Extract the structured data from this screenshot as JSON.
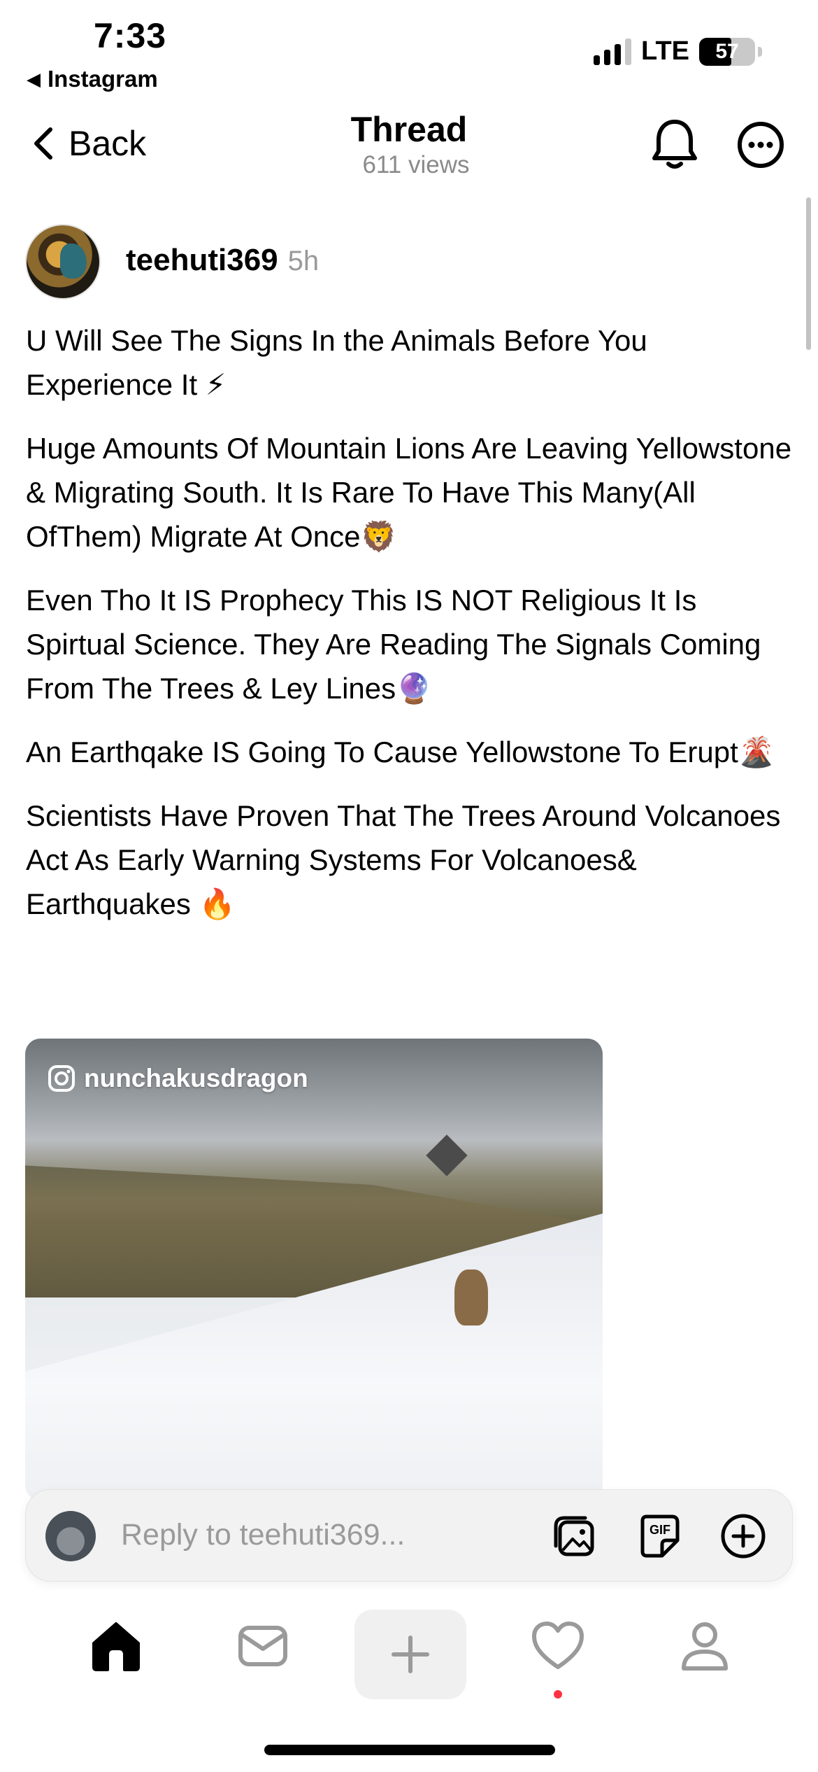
{
  "status_bar": {
    "time": "7:33",
    "back_app": "Instagram",
    "network": "LTE",
    "battery": "57"
  },
  "header": {
    "back_label": "Back",
    "title": "Thread",
    "views": "611 views"
  },
  "post": {
    "username": "teehuti369",
    "time_ago": "5h",
    "paragraphs": [
      "U Will See The Signs In the Animals Before You Experience It ⚡",
      "Huge Amounts Of Mountain Lions Are Leaving Yellowstone & Migrating South. It Is Rare To Have This Many(All OfThem) Migrate At Once🦁",
      "Even Tho It IS Prophecy This IS NOT Religious It Is Spirtual Science. They Are Reading The Signals Coming From The Trees & Ley Lines🔮",
      "An Earthqake IS Going To Cause Yellowstone To Erupt🌋",
      "Scientists Have Proven That The Trees Around Volcanoes Act As Early Warning Systems For Volcanoes&\nEarthquakes 🔥"
    ],
    "media": {
      "watermark": "nunchakusdragon"
    }
  },
  "reply_bar": {
    "placeholder": "Reply to teehuti369..."
  },
  "tab_bar": {
    "items": [
      "home-icon",
      "inbox-icon",
      "plus-icon",
      "heart-icon",
      "profile-icon"
    ],
    "active": "home-icon"
  },
  "colors": {
    "notification_dot": "#ff3040",
    "muted_text": "#999999"
  }
}
